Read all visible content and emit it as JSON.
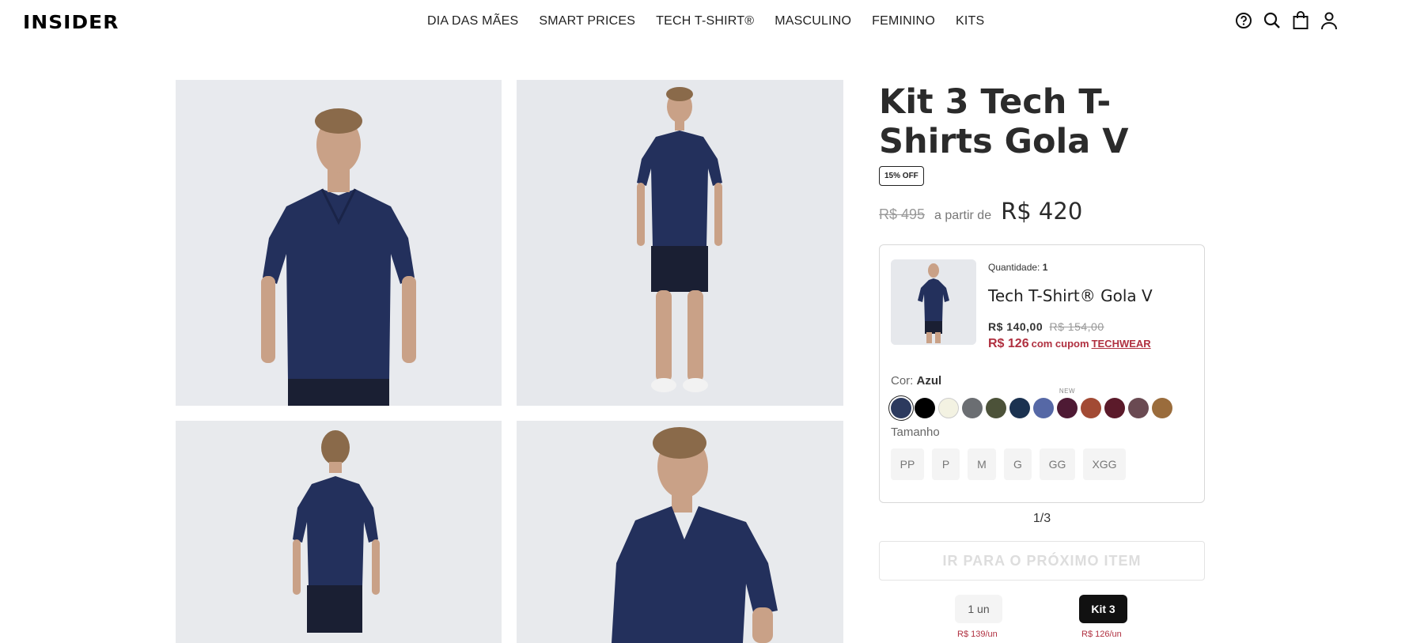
{
  "header": {
    "logo": "INSIDER",
    "nav": [
      "DIA DAS MÃES",
      "SMART PRICES",
      "TECH T-SHIRT®",
      "MASCULINO",
      "FEMININO",
      "KITS"
    ],
    "icons": [
      "help-icon",
      "search-icon",
      "bag-icon",
      "user-icon"
    ]
  },
  "product": {
    "title": "Kit 3 Tech T-Shirts Gola V",
    "badge": "15% OFF",
    "old_price": "R$ 495",
    "from_label": "a partir de",
    "price": "R$ 420"
  },
  "item": {
    "qty_label": "Quantidade:",
    "qty_value": "1",
    "name": "Tech T-Shirt® Gola V",
    "price": "R$ 140,00",
    "old_price": "R$ 154,00",
    "coupon_price": "R$ 126",
    "coupon_text": "com cupom",
    "coupon_code": "TECHWEAR",
    "color_label": "Cor:",
    "color_value": "Azul",
    "new_tag": "NEW",
    "size_label": "Tamanho",
    "sizes": [
      "PP",
      "P",
      "M",
      "G",
      "GG",
      "XGG"
    ],
    "swatch_colors": [
      "#2c3a5e",
      "#000000",
      "#f3f2e2",
      "#6b6e72",
      "#4c5239",
      "#1b3250",
      "#5668a6",
      "#4e1a34",
      "#a24a34",
      "#5b1a2a",
      "#6a4a52",
      "#9a6c3c"
    ]
  },
  "progress": "1/3",
  "next_button": "IR PARA O PRÓXIMO ITEM",
  "options": [
    {
      "label": "1 un",
      "price": "R$ 139/un"
    },
    {
      "label": "Kit 3",
      "price": "R$ 126/un"
    }
  ]
}
